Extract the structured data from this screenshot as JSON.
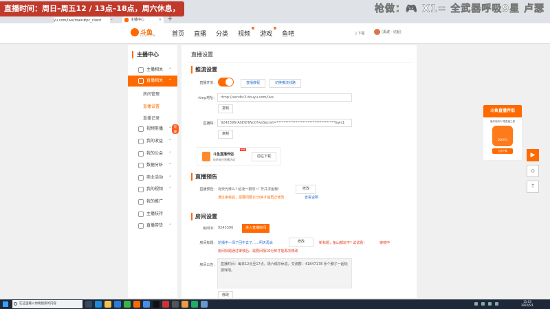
{
  "overlay": {
    "left_text": "直播时间：周日–周五12 / 13点–18点，周六休息，",
    "right_text": "枪做：🎮 X1= 全武器呼吸9星 卢瑟"
  },
  "browser": {
    "tab_title": "主播中心",
    "url": "yu.com/live/main#pc_client",
    "new_tab": "+"
  },
  "header": {
    "logo_text": "斗鱼",
    "logo_sub": "DOUYU.COM",
    "nav": [
      {
        "label": "首页",
        "badge": ""
      },
      {
        "label": "直播",
        "badge": ""
      },
      {
        "label": "分类",
        "badge": ""
      },
      {
        "label": "视频",
        "badge": "•"
      },
      {
        "label": "游戏",
        "badge": "•"
      },
      {
        "label": "鱼吧",
        "badge": ""
      }
    ],
    "download": "下载",
    "user": "(禹波 · 记起)"
  },
  "sidebar": {
    "title": "主播中心",
    "items": [
      {
        "label": "主播相关",
        "chev": "⌃"
      },
      {
        "label": "直播相关",
        "chev": "⌃"
      },
      {
        "label": "视频剪播",
        "chev": "⌃"
      },
      {
        "label": "我的收益",
        "chev": "⌃"
      },
      {
        "label": "我的公会",
        "chev": "⌃"
      },
      {
        "label": "数据分析",
        "chev": "⌃"
      },
      {
        "label": "商业活动",
        "chev": "⌃"
      },
      {
        "label": "我的视频",
        "chev": "⌃"
      },
      {
        "label": "我的推广",
        "chev": ""
      },
      {
        "label": "主播扶持",
        "chev": ""
      },
      {
        "label": "直播带货",
        "chev": "⌃"
      }
    ],
    "subitems": [
      "房间管理",
      "直播设置",
      "直播记录"
    ],
    "badge": "提醒"
  },
  "main": {
    "title": "直播设置",
    "stream": {
      "heading": "推流设置",
      "switch_label": "直播开关:",
      "tutorial_btn": "直播教程",
      "switch_line_btn": "切换推流线路",
      "rtmp_label": "rtmp地址:",
      "rtmp_value": "rtmp://sendtc3.douyu.com/live",
      "copy_btn": "复制",
      "code_label": "直播码:",
      "code_value": "9243396rAhE6HWc0?wsSecret=**********************************&ws1",
      "copy_btn2": "复制"
    },
    "promo": {
      "title": "斗鱼直播伴侣",
      "sub": "玩转每日直播活动",
      "new_tag": "NEW",
      "button": "前往下载"
    },
    "preview": {
      "heading": "直播预告",
      "label": "直播预告:",
      "text": "有荧光棒么? 给凌一根呗~! 符并求鱼粮!",
      "edit_btn": "修改",
      "note": "通过审核后，需要间隔10分钟才能再次修改",
      "note_link": "查看说明"
    },
    "room": {
      "heading": "房间设置",
      "id_label": "房间ID:",
      "id_value": "9243396",
      "enter_btn": "进入直播房间",
      "title_label": "房间标题:",
      "title_value": "轮播中—深了回不去了……明天再会",
      "title_edit_btn": "修改",
      "tip1": "新标题，鱼山都玩不? 试试看!",
      "tip2": "审核中",
      "title_note": "房间标题通过审核后，需要间隔10分钟才能再次修改",
      "notice_label": "房间公告:",
      "notice_text": "直播时间：每日12点至17点，周六偶尔休息。交流群：41847178 乐个膀子一起玩游戏吧。",
      "notice_edit_btn": "修改"
    }
  },
  "float_panel": {
    "head": "斗鱼直播伴侣",
    "sub": "最好用的PC端直播工具",
    "logo": "DOUYU",
    "button": "立即下载"
  },
  "taskbar": {
    "search_placeholder": "在这里输入你要搜索的内容",
    "time": "11:03",
    "date": "2022/5/1"
  }
}
